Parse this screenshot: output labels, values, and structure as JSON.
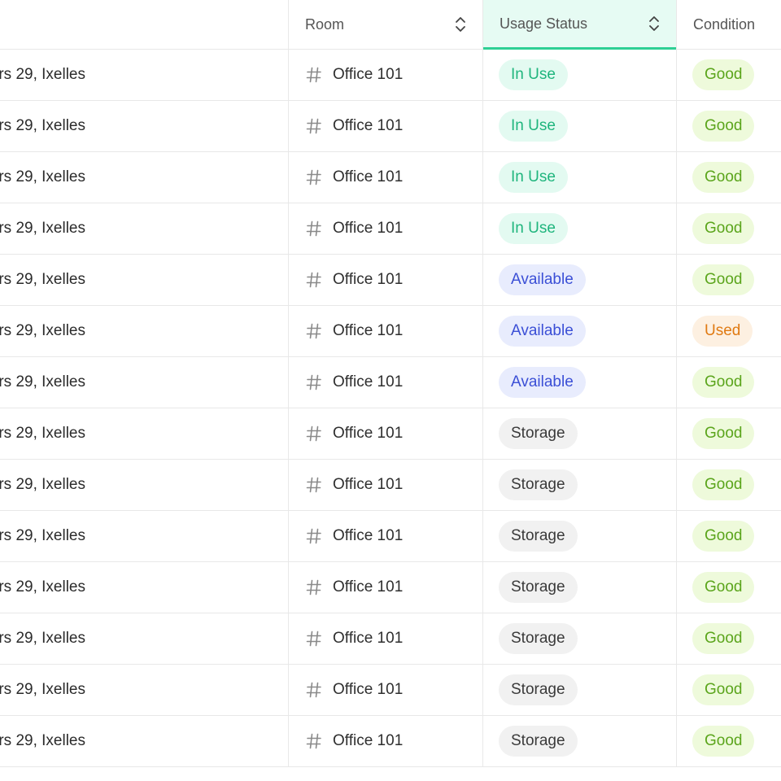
{
  "header": {
    "room_label": "Room",
    "usage_label": "Usage Status",
    "condition_label": "Condition"
  },
  "colors": {
    "in_use": "#1fb57d",
    "available": "#3b4fd6",
    "storage": "#3a3a3a",
    "good": "#5ba51c",
    "used": "#e07a12",
    "active_header": "#2ecf94"
  },
  "icons": {
    "room": "hash-icon",
    "sort": "sort-updown-icon"
  },
  "rows": [
    {
      "address": "rs 29, Ixelles",
      "room": "Office 101",
      "usage": "In Use",
      "usage_kind": "inuse",
      "condition": "Good",
      "condition_kind": "good"
    },
    {
      "address": "rs 29, Ixelles",
      "room": "Office 101",
      "usage": "In Use",
      "usage_kind": "inuse",
      "condition": "Good",
      "condition_kind": "good"
    },
    {
      "address": "rs 29, Ixelles",
      "room": "Office 101",
      "usage": "In Use",
      "usage_kind": "inuse",
      "condition": "Good",
      "condition_kind": "good"
    },
    {
      "address": "rs 29, Ixelles",
      "room": "Office 101",
      "usage": "In Use",
      "usage_kind": "inuse",
      "condition": "Good",
      "condition_kind": "good"
    },
    {
      "address": "rs 29, Ixelles",
      "room": "Office 101",
      "usage": "Available",
      "usage_kind": "available",
      "condition": "Good",
      "condition_kind": "good"
    },
    {
      "address": "rs 29, Ixelles",
      "room": "Office 101",
      "usage": "Available",
      "usage_kind": "available",
      "condition": "Used",
      "condition_kind": "used"
    },
    {
      "address": "rs 29, Ixelles",
      "room": "Office 101",
      "usage": "Available",
      "usage_kind": "available",
      "condition": "Good",
      "condition_kind": "good"
    },
    {
      "address": "rs 29, Ixelles",
      "room": "Office 101",
      "usage": "Storage",
      "usage_kind": "storage",
      "condition": "Good",
      "condition_kind": "good"
    },
    {
      "address": "rs 29, Ixelles",
      "room": "Office 101",
      "usage": "Storage",
      "usage_kind": "storage",
      "condition": "Good",
      "condition_kind": "good"
    },
    {
      "address": "rs 29, Ixelles",
      "room": "Office 101",
      "usage": "Storage",
      "usage_kind": "storage",
      "condition": "Good",
      "condition_kind": "good"
    },
    {
      "address": "rs 29, Ixelles",
      "room": "Office 101",
      "usage": "Storage",
      "usage_kind": "storage",
      "condition": "Good",
      "condition_kind": "good"
    },
    {
      "address": "rs 29, Ixelles",
      "room": "Office 101",
      "usage": "Storage",
      "usage_kind": "storage",
      "condition": "Good",
      "condition_kind": "good"
    },
    {
      "address": "rs 29, Ixelles",
      "room": "Office 101",
      "usage": "Storage",
      "usage_kind": "storage",
      "condition": "Good",
      "condition_kind": "good"
    },
    {
      "address": "rs 29, Ixelles",
      "room": "Office 101",
      "usage": "Storage",
      "usage_kind": "storage",
      "condition": "Good",
      "condition_kind": "good"
    }
  ]
}
